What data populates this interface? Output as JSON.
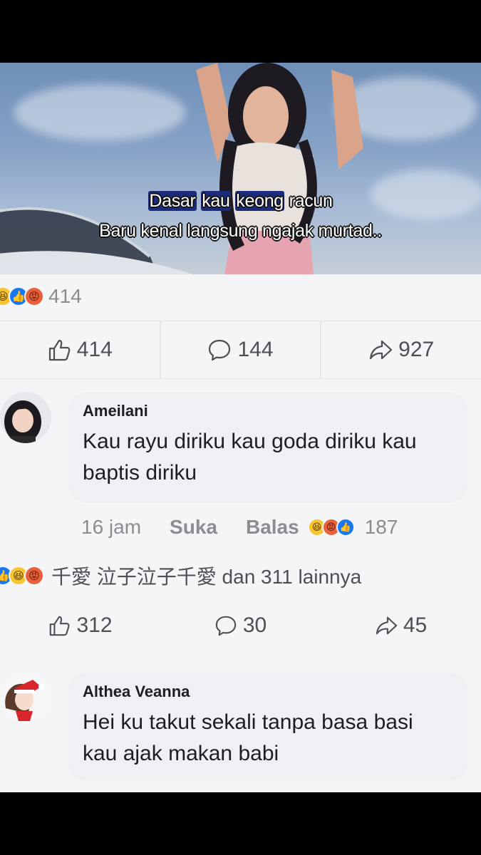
{
  "video": {
    "subtitle_line1_part1": "Dasar",
    "subtitle_line1_part2": "kau",
    "subtitle_line1_part3": "keong",
    "subtitle_line1_part4": "racun",
    "subtitle_line2": "Baru kenal langsung ngajak murtad.."
  },
  "post_reactions": {
    "count": "414"
  },
  "post_actions": {
    "likes": "414",
    "comments": "144",
    "shares": "927"
  },
  "comments": [
    {
      "name": "Ameilani",
      "text": "Kau rayu diriku kau goda diriku kau baptis diriku",
      "time": "16 jam",
      "like_label": "Suka",
      "reply_label": "Balas",
      "reaction_count": "187"
    },
    {
      "name": "Althea Veanna",
      "text": "Hei ku takut sekali tanpa basa basi kau ajak makan babi"
    }
  ],
  "reacted_by": {
    "text": "千愛 泣子泣子千愛 dan 311 lainnya"
  },
  "stats": {
    "likes": "312",
    "comments": "30",
    "shares": "45"
  },
  "colors": {
    "like_blue": "#1877f2",
    "haha_yellow": "#f7c531",
    "angry_orange": "#e8603c"
  }
}
